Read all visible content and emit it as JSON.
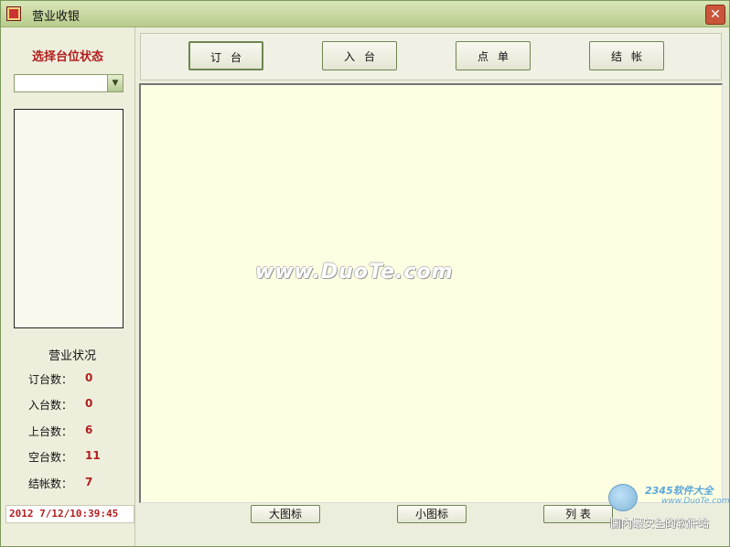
{
  "window": {
    "title": "营业收银",
    "close_icon": "✕"
  },
  "left_panel": {
    "status_title": "选择台位状态",
    "status_select": {
      "selected": "",
      "arrow": "▼"
    },
    "summary_title": "营业状况",
    "stats": [
      {
        "label": "订台数：",
        "value": "0"
      },
      {
        "label": "入台数：",
        "value": "0"
      },
      {
        "label": "上台数：",
        "value": "6"
      },
      {
        "label": "空台数：",
        "value": "11"
      },
      {
        "label": "结帐数：",
        "value": "7"
      }
    ],
    "datetime": "2012 7/12/10:39:45"
  },
  "toolbar": {
    "buttons": [
      {
        "label": "订台"
      },
      {
        "label": "入台"
      },
      {
        "label": "点单"
      },
      {
        "label": "结帐"
      }
    ]
  },
  "watermark": "www.DuoTe.com",
  "view_buttons": [
    {
      "label": "大图标"
    },
    {
      "label": "小图标"
    },
    {
      "label": "列 表"
    }
  ],
  "corner_logo": {
    "brand": "2345软件大全",
    "url": "www.DuoTe.com",
    "slogan": "国内最安全的软件站"
  },
  "colors": {
    "accent_red": "#b21e1e",
    "border_green": "#6e8651",
    "main_bg": "#fefee2"
  }
}
